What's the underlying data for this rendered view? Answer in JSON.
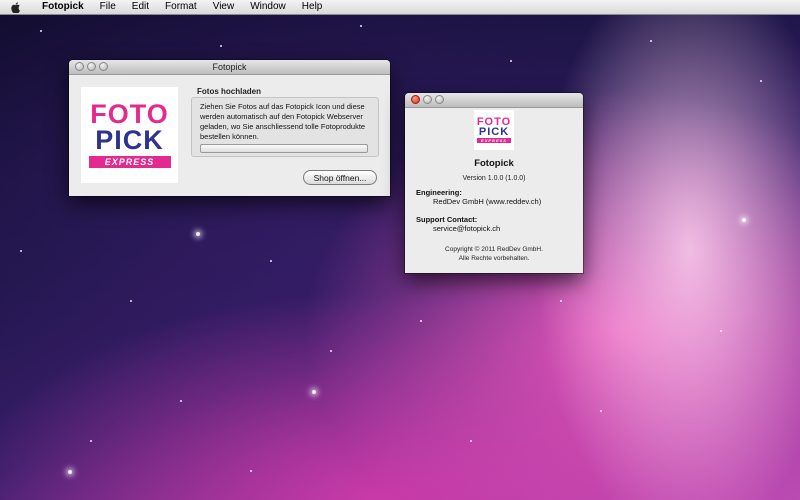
{
  "menubar": {
    "apple_icon": "apple-icon",
    "app_name": "Fotopick",
    "items": [
      "File",
      "Edit",
      "Format",
      "View",
      "Window",
      "Help"
    ]
  },
  "main_window": {
    "title": "Fotopick",
    "logo": {
      "line1": "FOTO",
      "line2": "PICK",
      "line3": "EXPRESS"
    },
    "group_title": "Fotos hochladen",
    "description": "Ziehen Sie Fotos auf das Fotopick Icon und diese werden automatisch auf den Fotopick Webserver geladen, wo Sie anschliessend tolle Fotoprodukte bestellen können.",
    "progress": 0,
    "shop_button": "Shop öffnen..."
  },
  "about_window": {
    "logo": {
      "line1": "FOTO",
      "line2": "PICK",
      "line3": "EXPRESS"
    },
    "app_name": "Fotopick",
    "version": "Version 1.0.0 (1.0.0)",
    "engineering_label": "Engineering:",
    "engineering_value": "RedDev GmbH (www.reddev.ch)",
    "support_label": "Support Contact:",
    "support_value": "service@fotopick.ch",
    "copyright_line1": "Copyright © 2011 RedDev GmbH.",
    "copyright_line2": "Alle Rechte vorbehalten."
  },
  "colors": {
    "logo_pink": "#e32b8f",
    "logo_blue": "#2e3392",
    "close_red": "#d62c1a"
  }
}
